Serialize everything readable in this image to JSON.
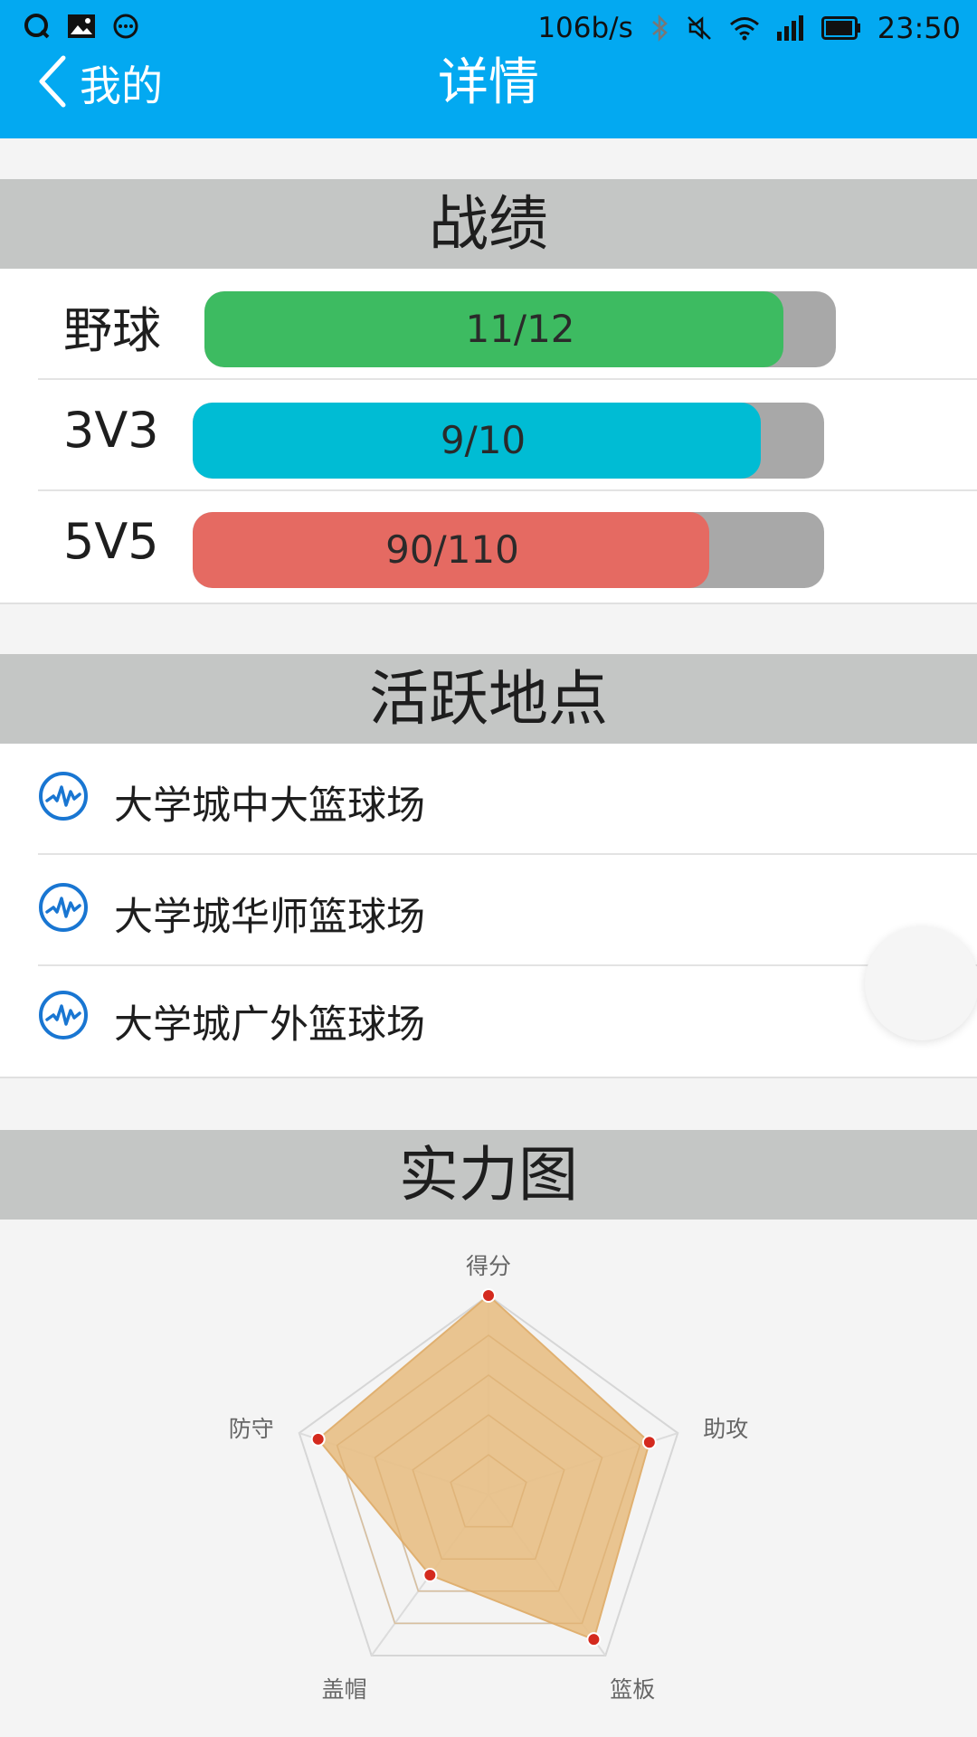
{
  "status_bar": {
    "network_rate": "106b/s",
    "time": "23:50"
  },
  "nav": {
    "back_label": "我的",
    "title": "详情"
  },
  "records": {
    "title": "战绩",
    "rows": [
      {
        "label": "野球",
        "text": "11/12",
        "fraction": 0.917,
        "color": "#3dbb61"
      },
      {
        "label": "3V3",
        "text": "9/10",
        "fraction": 0.9,
        "color": "#00bcd4"
      },
      {
        "label": "5V5",
        "text": "90/110",
        "fraction": 0.818,
        "color": "#e56a62"
      }
    ],
    "track_color": "#a8a8a8"
  },
  "places": {
    "title": "活跃地点",
    "items": [
      {
        "name": "大学城中大篮球场",
        "icon": "activity-icon"
      },
      {
        "name": "大学城华师篮球场",
        "icon": "activity-icon"
      },
      {
        "name": "大学城广外篮球场",
        "icon": "activity-icon"
      }
    ]
  },
  "strength": {
    "title": "实力图"
  },
  "chart_data": {
    "type": "radar",
    "axes": [
      "得分",
      "助攻",
      "篮板",
      "盖帽",
      "防守"
    ],
    "values": [
      100,
      85,
      90,
      50,
      90
    ],
    "max": 100,
    "levels": 5,
    "fill_color": "#e8bf85",
    "stroke_color": "#e0b070",
    "point_color": "#d42a1e"
  }
}
